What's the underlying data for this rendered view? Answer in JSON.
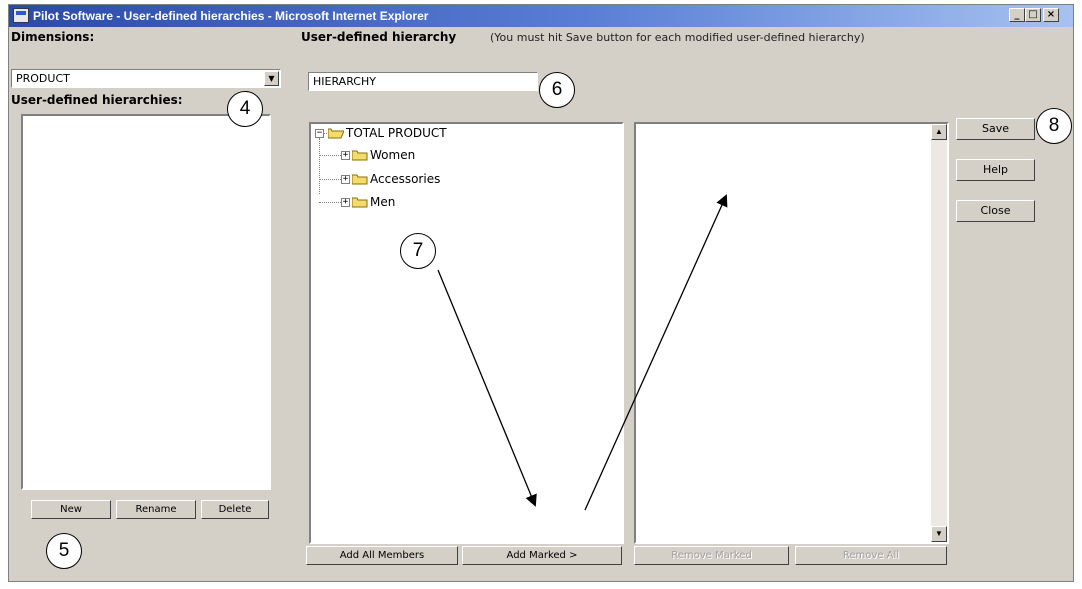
{
  "window": {
    "title": "Pilot Software - User-defined hierarchies - Microsoft Internet Explorer",
    "controls": [
      "_",
      "□",
      "×"
    ]
  },
  "left_panel": {
    "dimensions_label": "Dimensions:",
    "dimension_value": "PRODUCT",
    "hierarchies_label": "User-defined hierarchies:",
    "buttons": {
      "new": "New",
      "rename": "Rename",
      "delete": "Delete"
    }
  },
  "center_panel": {
    "hierarchy_label": "User-defined hierarchy",
    "hierarchy_note": "(You must hit Save button for each modified user-defined hierarchy)",
    "hierarchy_value": "HIERARCHY",
    "tree": {
      "root": "TOTAL PRODUCT",
      "children": [
        "Women",
        "Accessories",
        "Men"
      ]
    },
    "buttons": {
      "add_all": "Add All Members",
      "add_marked": "Add Marked >",
      "remove_marked": "Remove Marked",
      "remove_all": "Remove All"
    }
  },
  "side_buttons": {
    "save": "Save",
    "help": "Help",
    "close": "Close"
  },
  "callouts": [
    "4",
    "5",
    "6",
    "7",
    "8"
  ]
}
